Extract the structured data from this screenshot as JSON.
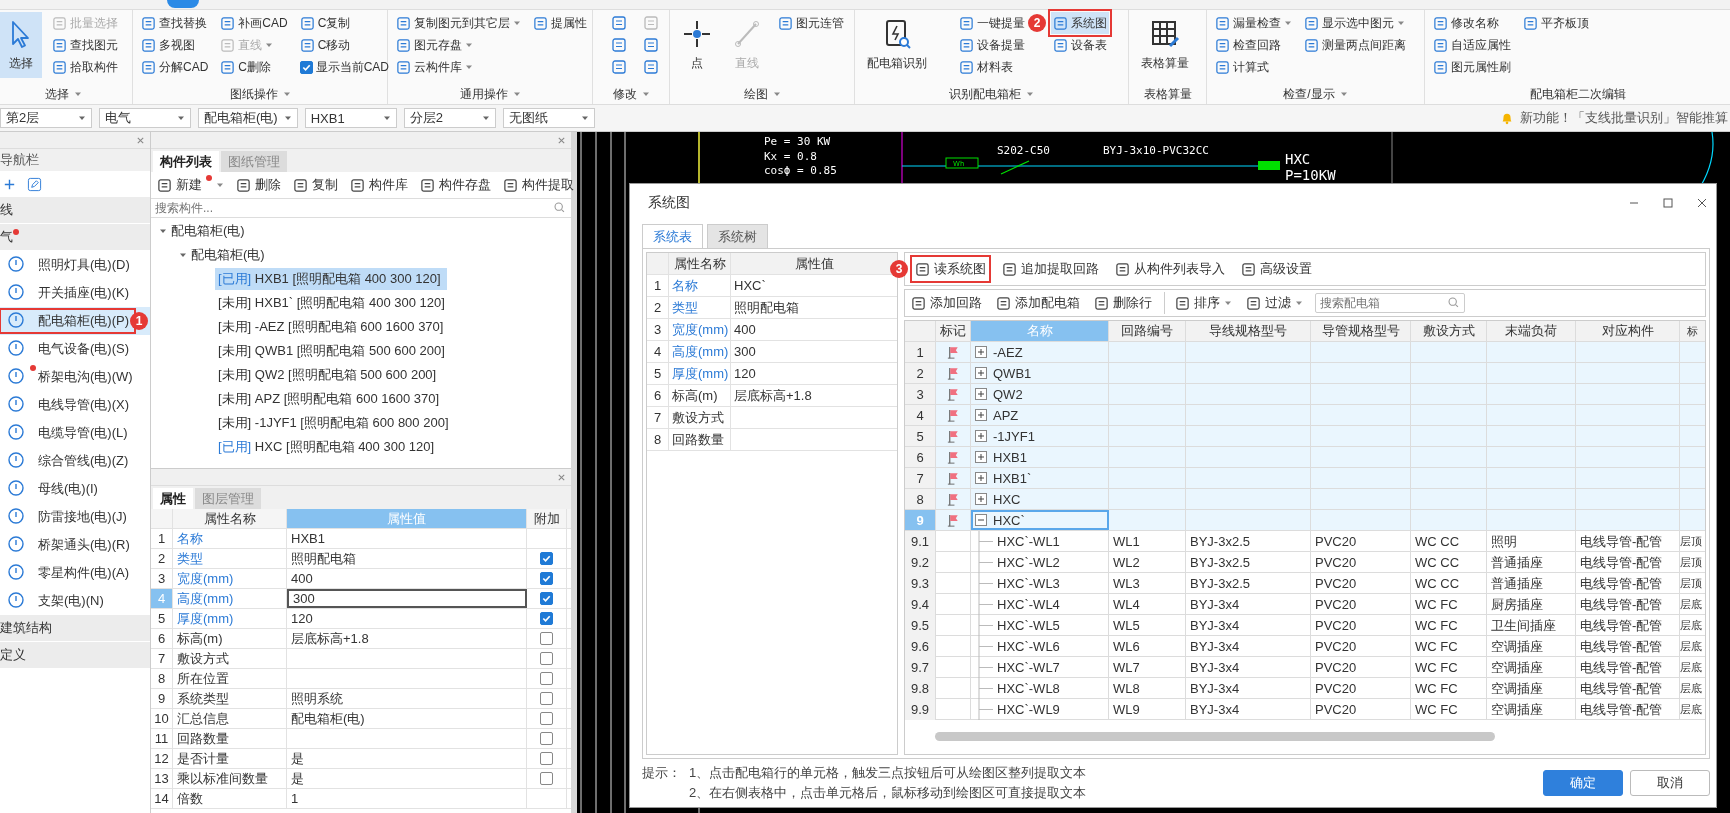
{
  "ribbon": {
    "groups": [
      {
        "label": "选择",
        "menu": true,
        "columns": [
          [
            {
              "kind": "large",
              "label": "选择",
              "selected": true,
              "disabled": false
            }
          ],
          [
            {
              "kind": "small",
              "label": "批量选择",
              "selected": false,
              "disabled": true,
              "dropdown": false
            },
            {
              "kind": "small",
              "label": "查找图元",
              "selected": false,
              "disabled": false,
              "dropdown": false
            },
            {
              "kind": "small",
              "label": "拾取构件",
              "selected": false,
              "disabled": false,
              "dropdown": false
            }
          ]
        ]
      },
      {
        "label": "图纸操作",
        "menu": true,
        "columns": [
          [
            {
              "kind": "small",
              "label": "查找替换",
              "selected": false,
              "disabled": false,
              "dropdown": false
            },
            {
              "kind": "small",
              "label": "多视图",
              "selected": false,
              "disabled": false,
              "dropdown": false
            },
            {
              "kind": "small",
              "label": "分解CAD",
              "selected": false,
              "disabled": false,
              "dropdown": false
            }
          ],
          [
            {
              "kind": "small",
              "label": "补画CAD",
              "selected": false,
              "disabled": false,
              "dropdown": false
            },
            {
              "kind": "small",
              "label": "直线",
              "selected": false,
              "disabled": true,
              "dropdown": true
            },
            {
              "kind": "small",
              "label": "C删除",
              "selected": false,
              "disabled": false,
              "dropdown": false
            }
          ],
          [
            {
              "kind": "small",
              "label": "C复制",
              "selected": false,
              "disabled": false,
              "dropdown": false
            },
            {
              "kind": "small",
              "label": "C移动",
              "selected": false,
              "disabled": false,
              "dropdown": false
            },
            {
              "kind": "check",
              "label": "显示当前CAD",
              "checked": true
            }
          ]
        ]
      },
      {
        "label": "通用操作",
        "menu": true,
        "columns": [
          [
            {
              "kind": "small",
              "label": "复制图元到其它层",
              "selected": false,
              "disabled": false,
              "dropdown": true
            },
            {
              "kind": "small",
              "label": "图元存盘",
              "selected": false,
              "disabled": false,
              "dropdown": true
            },
            {
              "kind": "small",
              "label": "云构件库",
              "selected": false,
              "disabled": false,
              "dropdown": true
            }
          ],
          [
            {
              "kind": "small",
              "label": "提属性",
              "selected": false,
              "disabled": false,
              "dropdown": false
            }
          ]
        ]
      },
      {
        "label": "修改",
        "menu": true,
        "columns": [
          [
            {
              "kind": "icon",
              "selected": false,
              "disabled": false
            },
            {
              "kind": "icon",
              "selected": false,
              "disabled": false
            },
            {
              "kind": "icon",
              "selected": false,
              "disabled": false
            }
          ],
          [
            {
              "kind": "icon",
              "selected": false,
              "disabled": true
            },
            {
              "kind": "icon",
              "selected": false,
              "disabled": false
            },
            {
              "kind": "icon",
              "selected": false,
              "disabled": false
            }
          ]
        ]
      },
      {
        "label": "绘图",
        "menu": true,
        "columns": [
          [
            {
              "kind": "large",
              "label": "点",
              "selected": false,
              "disabled": false
            }
          ],
          [
            {
              "kind": "large",
              "label": "直线",
              "selected": false,
              "disabled": true
            }
          ],
          [
            {
              "kind": "small",
              "label": "图元连管",
              "selected": false,
              "disabled": false,
              "dropdown": false
            }
          ]
        ]
      },
      {
        "label": "识别配电箱柜",
        "menu": true,
        "columns": [
          [
            {
              "kind": "large",
              "label": "配电箱识别",
              "selected": false,
              "disabled": false
            }
          ],
          [
            {
              "kind": "small",
              "label": "一键提量",
              "selected": false,
              "disabled": false,
              "dropdown": false
            },
            {
              "kind": "small",
              "label": "设备提量",
              "selected": false,
              "disabled": false,
              "dropdown": false
            },
            {
              "kind": "small",
              "label": "材料表",
              "selected": false,
              "disabled": false,
              "dropdown": false
            }
          ],
          [
            {
              "kind": "small",
              "label": "系统图",
              "selected": true,
              "disabled": false,
              "dropdown": false,
              "annotation": "2"
            },
            {
              "kind": "small",
              "label": "设备表",
              "selected": false,
              "disabled": false,
              "dropdown": false
            }
          ]
        ]
      },
      {
        "label": "表格算量",
        "menu": false,
        "columns": [
          [
            {
              "kind": "large",
              "label": "表格算量",
              "selected": false,
              "disabled": false
            }
          ]
        ]
      },
      {
        "label": "检查/显示",
        "menu": true,
        "columns": [
          [
            {
              "kind": "small",
              "label": "漏量检查",
              "selected": false,
              "disabled": false,
              "dropdown": true
            },
            {
              "kind": "small",
              "label": "检查回路",
              "selected": false,
              "disabled": false,
              "dropdown": false
            },
            {
              "kind": "small",
              "label": "计算式",
              "selected": false,
              "disabled": false,
              "dropdown": false
            }
          ],
          [
            {
              "kind": "small",
              "label": "显示选中图元",
              "selected": false,
              "disabled": false,
              "dropdown": true
            },
            {
              "kind": "small",
              "label": "测量两点间距离",
              "selected": false,
              "disabled": false,
              "dropdown": false
            }
          ]
        ]
      },
      {
        "label": "配电箱柜二次编辑",
        "menu": false,
        "columns": [
          [
            {
              "kind": "small",
              "label": "修改名称",
              "selected": false,
              "disabled": false,
              "dropdown": false
            },
            {
              "kind": "small",
              "label": "自适应属性",
              "selected": false,
              "disabled": false,
              "dropdown": false
            },
            {
              "kind": "small",
              "label": "图元属性刷",
              "selected": false,
              "disabled": false,
              "dropdown": false
            }
          ],
          [
            {
              "kind": "small",
              "label": "平齐板顶",
              "selected": false,
              "disabled": false,
              "dropdown": false
            }
          ]
        ]
      }
    ]
  },
  "selectors": [
    "第2层",
    "电气",
    "配电箱柜(电)",
    "HXB1",
    "分层2",
    "无图纸"
  ],
  "notice": "新功能！「支线批量识别」智能推算",
  "nav": {
    "title": "导航栏",
    "sections": [
      {
        "label": "线",
        "dot": false
      },
      {
        "label": "气",
        "dot": true,
        "items": [
          {
            "label": "照明灯具(电)(D)",
            "selected": false,
            "dot": false
          },
          {
            "label": "开关插座(电)(K)",
            "selected": false,
            "dot": false
          },
          {
            "label": "配电箱柜(电)(P)",
            "selected": true,
            "dot": false,
            "annotation": "1"
          },
          {
            "label": "电气设备(电)(S)",
            "selected": false,
            "dot": false
          },
          {
            "label": "桥架电沟(电)(W)",
            "selected": false,
            "dot": true
          },
          {
            "label": "电线导管(电)(X)",
            "selected": false,
            "dot": false
          },
          {
            "label": "电缆导管(电)(L)",
            "selected": false,
            "dot": false
          },
          {
            "label": "综合管线(电)(Z)",
            "selected": false,
            "dot": false
          },
          {
            "label": "母线(电)(I)",
            "selected": false,
            "dot": false
          },
          {
            "label": "防雷接地(电)(J)",
            "selected": false,
            "dot": false
          },
          {
            "label": "桥架通头(电)(R)",
            "selected": false,
            "dot": false
          },
          {
            "label": "零星构件(电)(A)",
            "selected": false,
            "dot": false
          },
          {
            "label": "支架(电)(N)",
            "selected": false,
            "dot": false
          }
        ]
      },
      {
        "label": "建筑结构",
        "dot": false
      },
      {
        "label": "定义",
        "dot": false
      }
    ]
  },
  "components": {
    "tabs": [
      {
        "label": "构件列表",
        "selected": true
      },
      {
        "label": "图纸管理",
        "selected": false
      }
    ],
    "toolbar": [
      {
        "label": "新建",
        "dropdown": true,
        "dot": true
      },
      {
        "label": "删除",
        "dropdown": false,
        "dot": false
      },
      {
        "label": "复制",
        "dropdown": false,
        "dot": false
      },
      {
        "label": "构件库",
        "dropdown": false,
        "dot": false
      },
      {
        "label": "构件存盘",
        "dropdown": false,
        "dot": false
      },
      {
        "label": "构件提取",
        "dropdown": false,
        "dot": false
      }
    ],
    "search": {
      "placeholder": "搜索构件..."
    },
    "tree": [
      {
        "label": "配电箱柜(电)",
        "expanded": true,
        "children": [
          {
            "label": "配电箱柜(电)",
            "expanded": true,
            "children": [
              {
                "status": "[已用]",
                "label": "HXB1 [照明配电箱 400 300 120]",
                "used": true,
                "selected": true
              },
              {
                "status": "[未用]",
                "label": "HXB1` [照明配电箱 400 300 120]",
                "used": false,
                "selected": false
              },
              {
                "status": "[未用]",
                "label": "-AEZ [照明配电箱 600 1600 370]",
                "used": false,
                "selected": false
              },
              {
                "status": "[未用]",
                "label": "QWB1 [照明配电箱 500 600 200]",
                "used": false,
                "selected": false
              },
              {
                "status": "[未用]",
                "label": "QW2 [照明配电箱 500 600 200]",
                "used": false,
                "selected": false
              },
              {
                "status": "[未用]",
                "label": "APZ [照明配电箱 600 1600 370]",
                "used": false,
                "selected": false
              },
              {
                "status": "[未用]",
                "label": "-1JYF1 [照明配电箱 600 800 200]",
                "used": false,
                "selected": false
              },
              {
                "status": "[已用]",
                "label": "HXC [照明配电箱 400 300 120]",
                "used": true,
                "selected": false
              }
            ]
          }
        ]
      }
    ]
  },
  "properties": {
    "tabs": [
      {
        "label": "属性",
        "selected": true
      },
      {
        "label": "图层管理",
        "selected": false
      }
    ],
    "columns": [
      {
        "label": "属性名称",
        "selected": false
      },
      {
        "label": "属性值",
        "selected": true
      },
      {
        "label": "附加",
        "selected": false
      }
    ],
    "rows": [
      {
        "num": "1",
        "name": "名称",
        "value": "HXB1",
        "public": true,
        "selected": false
      },
      {
        "num": "2",
        "name": "类型",
        "value": "照明配电箱",
        "public": true,
        "selected": false,
        "checked": true
      },
      {
        "num": "3",
        "name": "宽度(mm)",
        "value": "400",
        "public": true,
        "selected": false,
        "checked": true
      },
      {
        "num": "4",
        "name": "高度(mm)",
        "value": "300",
        "public": true,
        "selected": true,
        "checked": true
      },
      {
        "num": "5",
        "name": "厚度(mm)",
        "value": "120",
        "public": true,
        "selected": false,
        "checked": true
      },
      {
        "num": "6",
        "name": "标高(m)",
        "value": "层底标高+1.8",
        "public": false,
        "selected": false,
        "checked": false
      },
      {
        "num": "7",
        "name": "敷设方式",
        "public": false,
        "selected": false,
        "checked": false
      },
      {
        "num": "8",
        "name": "所在位置",
        "public": false,
        "selected": false,
        "checked": false
      },
      {
        "num": "9",
        "name": "系统类型",
        "value": "照明系统",
        "public": false,
        "selected": false,
        "checked": false
      },
      {
        "num": "10",
        "name": "汇总信息",
        "value": "配电箱柜(电)",
        "public": false,
        "selected": false,
        "checked": false
      },
      {
        "num": "11",
        "name": "回路数量",
        "public": false,
        "selected": false,
        "checked": false
      },
      {
        "num": "12",
        "name": "是否计量",
        "value": "是",
        "public": false,
        "selected": false,
        "checked": false
      },
      {
        "num": "13",
        "name": "乘以标准间数量",
        "value": "是",
        "public": false,
        "selected": false,
        "checked": false
      },
      {
        "num": "14",
        "name": "倍数",
        "value": "1",
        "public": false,
        "selected": false
      }
    ]
  },
  "cad_drawing": {
    "labels": [
      "Pe = 30 KW",
      "Kx = 0.8",
      "cosϕ = 0.85",
      "S202-C50",
      "BYJ-3x10-PVC32CC",
      "HXC",
      "P=10KW",
      "Wh"
    ]
  },
  "dialog": {
    "title": "系统图",
    "tabs": [
      {
        "label": "系统表",
        "selected": true
      },
      {
        "label": "系统树",
        "selected": false
      }
    ],
    "properties": {
      "columns": [
        "属性名称",
        "属性值"
      ],
      "rows": [
        {
          "num": "1",
          "name": "名称",
          "value": "HXC`",
          "public": true
        },
        {
          "num": "2",
          "name": "类型",
          "value": "照明配电箱",
          "public": true
        },
        {
          "num": "3",
          "name": "宽度(mm)",
          "value": "400",
          "public": true
        },
        {
          "num": "4",
          "name": "高度(mm)",
          "value": "300",
          "public": true
        },
        {
          "num": "5",
          "name": "厚度(mm)",
          "value": "120",
          "public": true
        },
        {
          "num": "6",
          "name": "标高(m)",
          "value": "层底标高+1.8",
          "public": false
        },
        {
          "num": "7",
          "name": "敷设方式",
          "public": false
        },
        {
          "num": "8",
          "name": "回路数量",
          "public": false
        }
      ]
    },
    "toolbar": [
      {
        "label": "读系统图",
        "annotation": "3"
      },
      {
        "label": "追加提取回路"
      },
      {
        "label": "从构件列表导入"
      },
      {
        "label": "高级设置"
      }
    ],
    "toolbar_2": [
      {
        "label": "添加回路",
        "dropdown": false,
        "separator_before": false
      },
      {
        "label": "添加配电箱",
        "dropdown": false,
        "separator_before": false
      },
      {
        "label": "删除行",
        "dropdown": false,
        "separator_before": false
      },
      {
        "label": "排序",
        "dropdown": true,
        "separator_before": true
      },
      {
        "label": "过滤",
        "dropdown": true,
        "separator_before": false
      }
    ],
    "search": {
      "placeholder": "搜索配电箱"
    },
    "grid": {
      "columns": [
        {
          "label": "标记",
          "selected": false
        },
        {
          "label": "名称",
          "selected": true
        },
        {
          "label": "回路编号",
          "selected": false
        },
        {
          "label": "导线规格型号",
          "selected": false
        },
        {
          "label": "导管规格型号",
          "selected": false
        },
        {
          "label": "敷设方式",
          "selected": false
        },
        {
          "label": "末端负荷",
          "selected": false
        },
        {
          "label": "对应构件",
          "selected": false
        },
        {
          "label": "标",
          "selected": false
        }
      ],
      "rows": [
        {
          "num": "1",
          "kind": "box",
          "flag": true,
          "expanded": false,
          "name": "-AEZ",
          "selected": false
        },
        {
          "num": "2",
          "kind": "box",
          "flag": true,
          "expanded": false,
          "name": "QWB1",
          "selected": false
        },
        {
          "num": "3",
          "kind": "box",
          "flag": true,
          "expanded": false,
          "name": "QW2",
          "selected": false
        },
        {
          "num": "4",
          "kind": "box",
          "flag": true,
          "expanded": false,
          "name": "APZ",
          "selected": false
        },
        {
          "num": "5",
          "kind": "box",
          "flag": true,
          "expanded": false,
          "name": "-1JYF1",
          "selected": false
        },
        {
          "num": "6",
          "kind": "box",
          "flag": true,
          "expanded": false,
          "name": "HXB1",
          "selected": false
        },
        {
          "num": "7",
          "kind": "box",
          "flag": true,
          "expanded": false,
          "name": "HXB1`",
          "selected": false
        },
        {
          "num": "8",
          "kind": "box",
          "flag": true,
          "expanded": false,
          "name": "HXC",
          "selected": false
        },
        {
          "num": "9",
          "kind": "box",
          "flag": true,
          "expanded": true,
          "name": "HXC`",
          "selected": true
        },
        {
          "num": "9.1",
          "kind": "circuit",
          "flag": false,
          "name": "HXC`-WL1",
          "circuit": "WL1",
          "wire": "BYJ-3x2.5",
          "conduit": "PVC20",
          "laying": "WC CC",
          "load": "照明",
          "component": "电线导管-配管",
          "column_9": "层顶",
          "selected": false
        },
        {
          "num": "9.2",
          "kind": "circuit",
          "flag": false,
          "name": "HXC`-WL2",
          "circuit": "WL2",
          "wire": "BYJ-3x2.5",
          "conduit": "PVC20",
          "laying": "WC CC",
          "load": "普通插座",
          "component": "电线导管-配管",
          "column_9": "层顶",
          "selected": false
        },
        {
          "num": "9.3",
          "kind": "circuit",
          "flag": false,
          "name": "HXC`-WL3",
          "circuit": "WL3",
          "wire": "BYJ-3x2.5",
          "conduit": "PVC20",
          "laying": "WC CC",
          "load": "普通插座",
          "component": "电线导管-配管",
          "column_9": "层顶",
          "selected": false
        },
        {
          "num": "9.4",
          "kind": "circuit",
          "flag": false,
          "name": "HXC`-WL4",
          "circuit": "WL4",
          "wire": "BYJ-3x4",
          "conduit": "PVC20",
          "laying": "WC FC",
          "load": "厨房插座",
          "component": "电线导管-配管",
          "column_9": "层底",
          "selected": false
        },
        {
          "num": "9.5",
          "kind": "circuit",
          "flag": false,
          "name": "HXC`-WL5",
          "circuit": "WL5",
          "wire": "BYJ-3x4",
          "conduit": "PVC20",
          "laying": "WC FC",
          "load": "卫生间插座",
          "component": "电线导管-配管",
          "column_9": "层底",
          "selected": false
        },
        {
          "num": "9.6",
          "kind": "circuit",
          "flag": false,
          "name": "HXC`-WL6",
          "circuit": "WL6",
          "wire": "BYJ-3x4",
          "conduit": "PVC20",
          "laying": "WC FC",
          "load": "空调插座",
          "component": "电线导管-配管",
          "column_9": "层底",
          "selected": false
        },
        {
          "num": "9.7",
          "kind": "circuit",
          "flag": false,
          "name": "HXC`-WL7",
          "circuit": "WL7",
          "wire": "BYJ-3x4",
          "conduit": "PVC20",
          "laying": "WC FC",
          "load": "空调插座",
          "component": "电线导管-配管",
          "column_9": "层底",
          "selected": false
        },
        {
          "num": "9.8",
          "kind": "circuit",
          "flag": false,
          "name": "HXC`-WL8",
          "circuit": "WL8",
          "wire": "BYJ-3x4",
          "conduit": "PVC20",
          "laying": "WC FC",
          "load": "空调插座",
          "component": "电线导管-配管",
          "column_9": "层底",
          "selected": false
        },
        {
          "num": "9.9",
          "kind": "circuit",
          "flag": false,
          "name": "HXC`-WL9",
          "circuit": "WL9",
          "wire": "BYJ-3x4",
          "conduit": "PVC20",
          "laying": "WC FC",
          "load": "空调插座",
          "component": "电线导管-配管",
          "column_9": "层底",
          "selected": false
        }
      ]
    },
    "hint": {
      "label": "提示：",
      "lines": [
        "1、点击配电箱行的单元格，触发三点按钮后可从绘图区整列提取文本",
        "2、在右侧表格中，点击单元格后，鼠标移动到绘图区可直接提取文本"
      ]
    },
    "buttons": [
      {
        "label": "确定",
        "primary": true
      },
      {
        "label": "取消",
        "primary": false
      }
    ]
  }
}
